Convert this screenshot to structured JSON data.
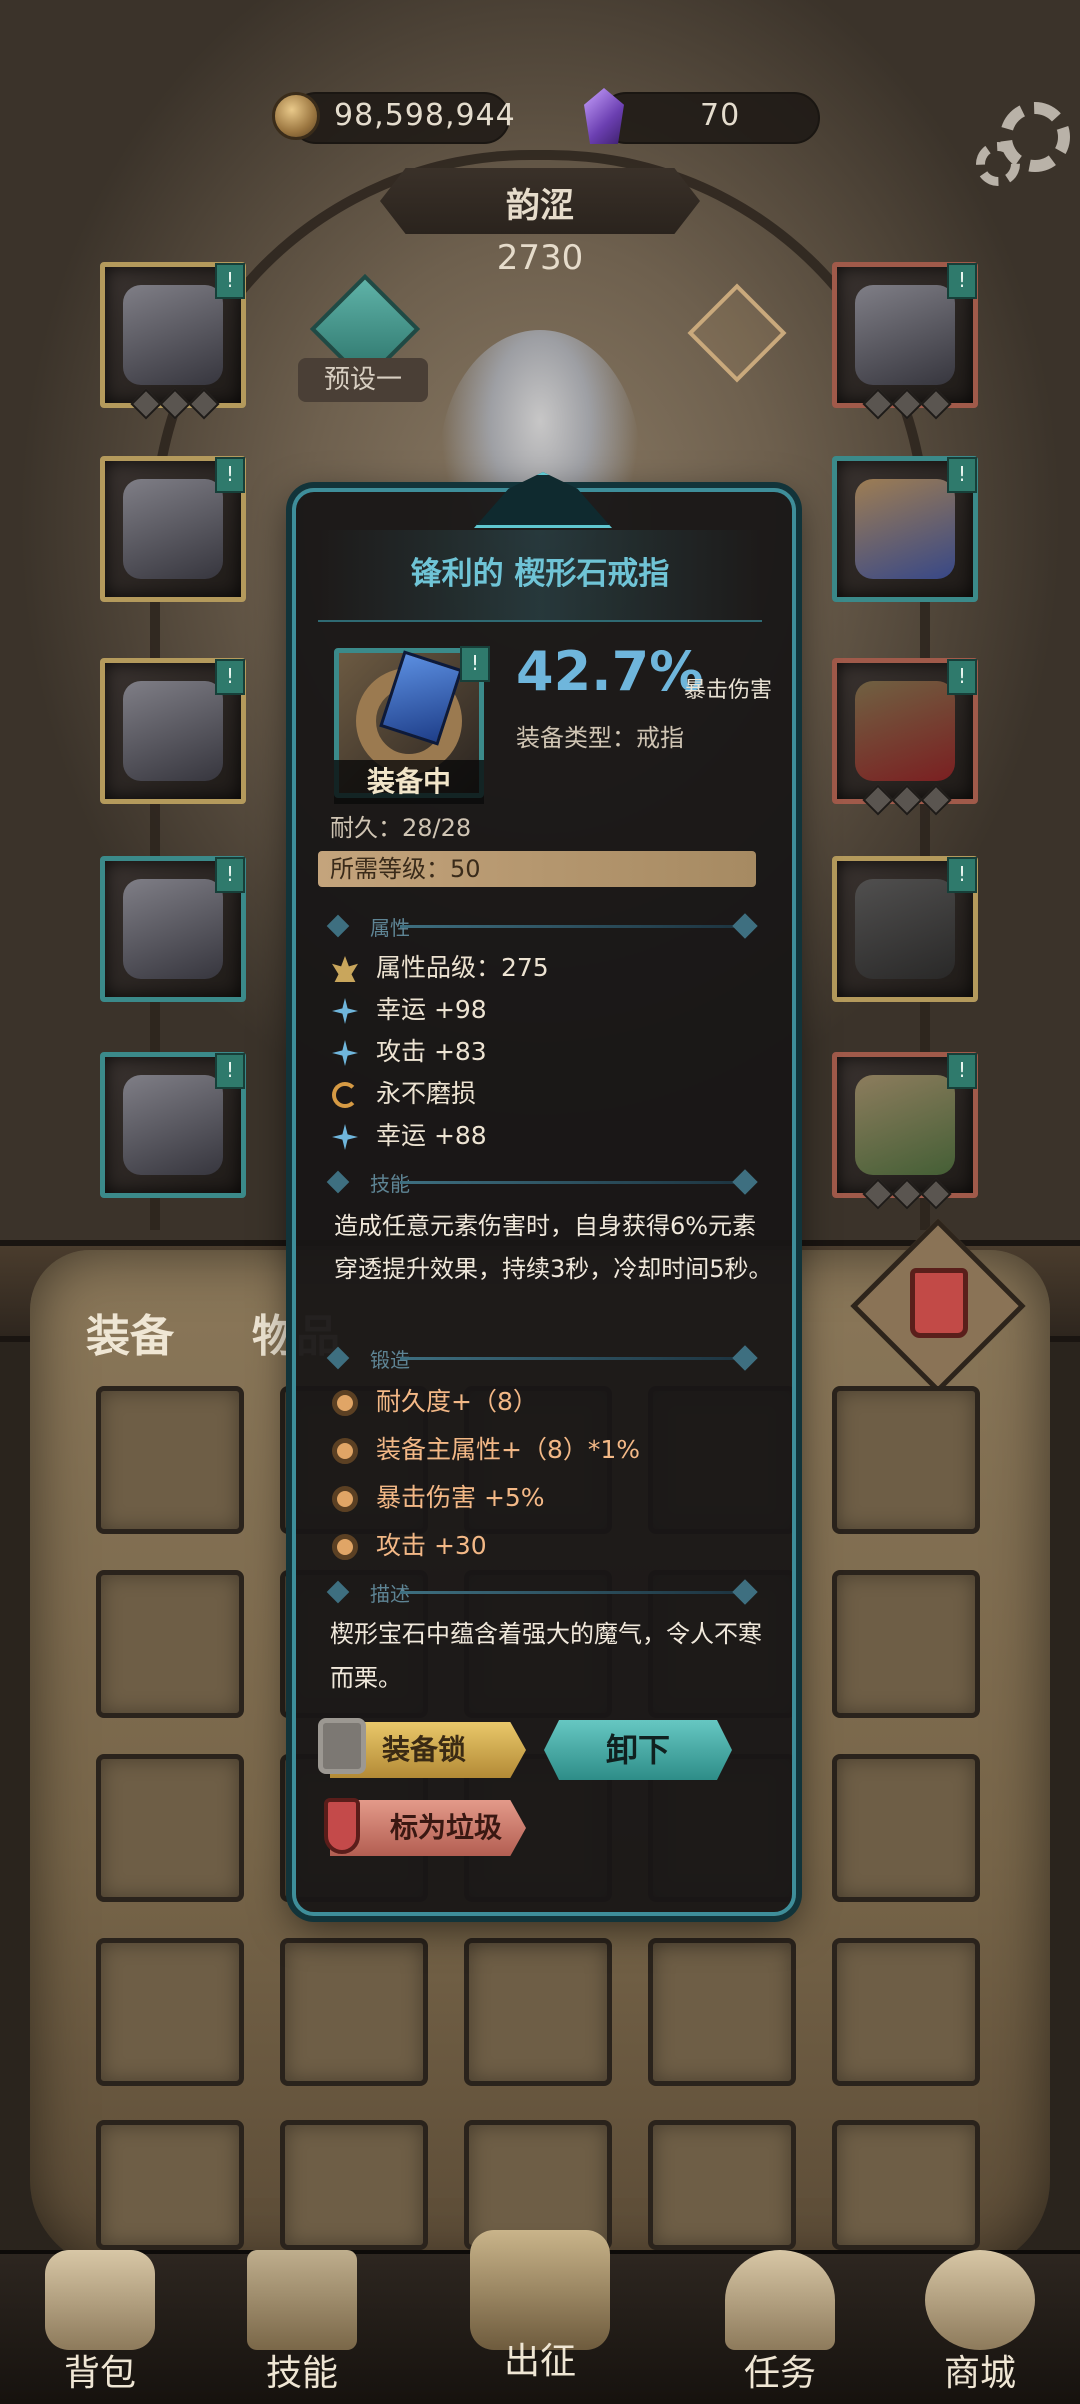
{
  "currency": {
    "coins": "98,598,944",
    "gems": "70"
  },
  "hero": {
    "name": "韵涩",
    "power": "2730",
    "preset_label": "预设一"
  },
  "tooltip": {
    "title": "锋利的 楔形石戒指",
    "equipped_label": "装备中",
    "primary_value": "42.7%",
    "primary_label": "暴击伤害",
    "type_text": "装备类型：戒指",
    "durability": "耐久：28/28",
    "required_level": "所需等级：50",
    "sections": {
      "attributes": "属性",
      "skill": "技能",
      "forge": "锻造",
      "description": "描述"
    },
    "attributes": [
      {
        "icon": "lotus-icon",
        "text": "属性品级：275"
      },
      {
        "icon": "star-icon",
        "text": "幸运 +98"
      },
      {
        "icon": "star-icon",
        "text": "攻击 +83"
      },
      {
        "icon": "cycle-icon",
        "text": "永不磨损"
      },
      {
        "icon": "star-icon",
        "text": "幸运 +88"
      }
    ],
    "skill_text": "造成任意元素伤害时，自身获得6%元素穿透提升效果，持续3秒，冷却时间5秒。",
    "forge": [
      "耐久度+（8）",
      "装备主属性+（8）*1%",
      "暴击伤害 +5%",
      "攻击 +30"
    ],
    "description": "楔形宝石中蕴含着强大的魔气，令人不寒而栗。",
    "buttons": {
      "lock": "装备锁",
      "unequip": "卸下",
      "junk": "标为垃圾"
    }
  },
  "bag": {
    "tabs": [
      "装备",
      "物品"
    ]
  },
  "nav": [
    "背包",
    "技能",
    "出征",
    "任务",
    "商城"
  ],
  "colors": {
    "accent_teal": "#3e8e9a",
    "crit_blue": "#6fb6dc",
    "forge_orange": "#f3b886"
  }
}
